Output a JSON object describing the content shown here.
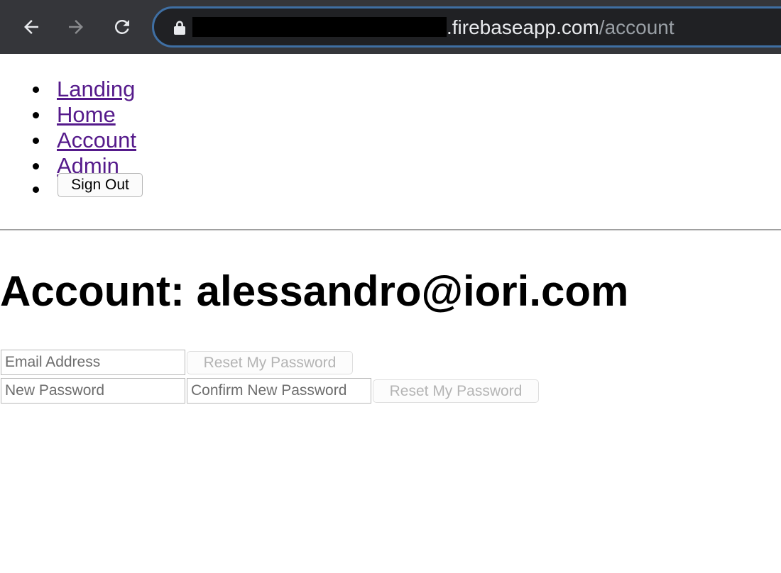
{
  "browser": {
    "url_host": ".firebaseapp.com",
    "url_path": "/account"
  },
  "nav": {
    "links": [
      {
        "label": "Landing"
      },
      {
        "label": "Home"
      },
      {
        "label": "Account"
      },
      {
        "label": "Admin"
      }
    ],
    "signout_label": "Sign Out"
  },
  "page": {
    "title": "Account: alessandro@iori.com"
  },
  "reset_form": {
    "email_placeholder": "Email Address",
    "email_value": "",
    "submit_label": "Reset My Password"
  },
  "change_form": {
    "new_password_placeholder": "New Password",
    "new_password_value": "",
    "confirm_placeholder": "Confirm New Password",
    "confirm_value": "",
    "submit_label": "Reset My Password"
  },
  "colors": {
    "toolbar_bg": "#35363a",
    "omnibox_bg": "#202124",
    "omnibox_focus_ring": "#3f6fa3",
    "visited_link": "#551a8b",
    "disabled_text": "#b4b4b4"
  }
}
